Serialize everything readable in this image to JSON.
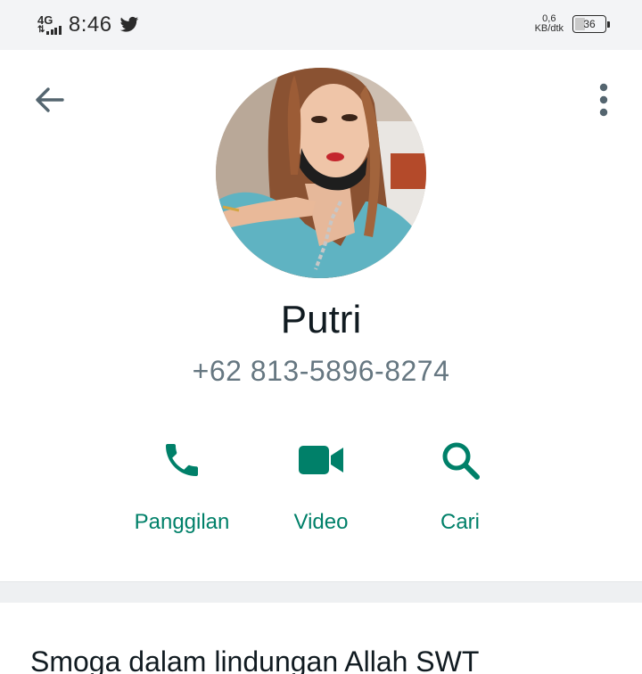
{
  "status_bar": {
    "network": "4G",
    "time": "8:46",
    "speed_value": "0,6",
    "speed_unit": "KB/dtk",
    "battery": "36",
    "battery_level": 0.36,
    "notification_icon": "twitter-icon"
  },
  "header": {
    "back_icon": "arrow-left-icon",
    "menu_icon": "more-vert-icon"
  },
  "contact": {
    "name": "Putri",
    "phone": "+62 813-5896-8274"
  },
  "actions": [
    {
      "label": "Panggilan",
      "icon": "phone-icon"
    },
    {
      "label": "Video",
      "icon": "video-camera-icon"
    },
    {
      "label": "Cari",
      "icon": "search-icon"
    }
  ],
  "about": {
    "text": "Smoga dalam lindungan Allah SWT"
  },
  "colors": {
    "accent": "#008069",
    "secondary_text": "#667781",
    "primary_text": "#111b21",
    "status_bar_bg": "#f3f4f6"
  }
}
